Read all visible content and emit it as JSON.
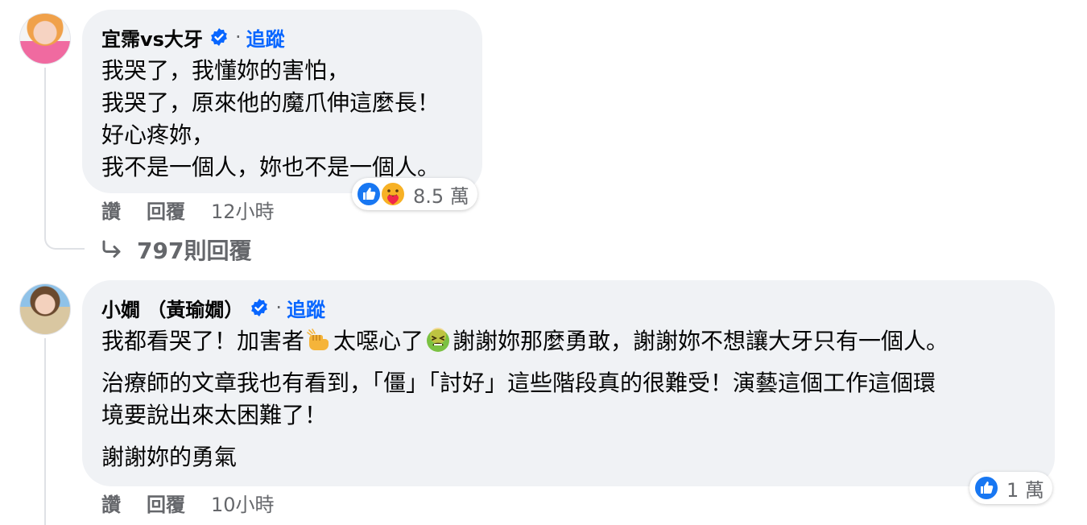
{
  "comments": [
    {
      "author": "宜霈vs大牙",
      "follow_label": "追蹤",
      "separator": "·",
      "lines": [
        "我哭了，我懂妳的害怕，",
        "我哭了，原來他的魔爪伸這麼長！",
        "好心疼妳，",
        "我不是一個人，妳也不是一個人。"
      ],
      "actions": {
        "like": "讚",
        "reply": "回覆",
        "time": "12小時"
      },
      "reaction_count": "8.5 萬",
      "reactions": [
        "like-icon",
        "care-icon"
      ],
      "replies_label": "797則回覆"
    },
    {
      "author": "小嫺 （黃瑜嫺）",
      "follow_label": "追蹤",
      "separator": "·",
      "p1_a": "我都看哭了！加害者",
      "p1_b": "太噁心了",
      "p1_c": "謝謝妳那麼勇敢，謝謝妳不想讓大牙只有一個人。",
      "p2_l1": "治療師的文章我也有看到，「僵」「討好」這些階段真的很難受！演藝這個工作這個環",
      "p2_l2": "境要說出來太困難了！",
      "p3": "謝謝妳的勇氣",
      "emojis": [
        "punch-fist-emoji",
        "nauseated-face-emoji"
      ],
      "actions": {
        "like": "讚",
        "reply": "回覆",
        "time": "10小時"
      },
      "reaction_count": "1 萬",
      "reactions": [
        "like-icon"
      ]
    }
  ],
  "colors": {
    "bubble": "#f0f2f5",
    "accent": "#0866ff",
    "secondary_text": "#65676b",
    "thread_line": "#dfe1e5"
  }
}
